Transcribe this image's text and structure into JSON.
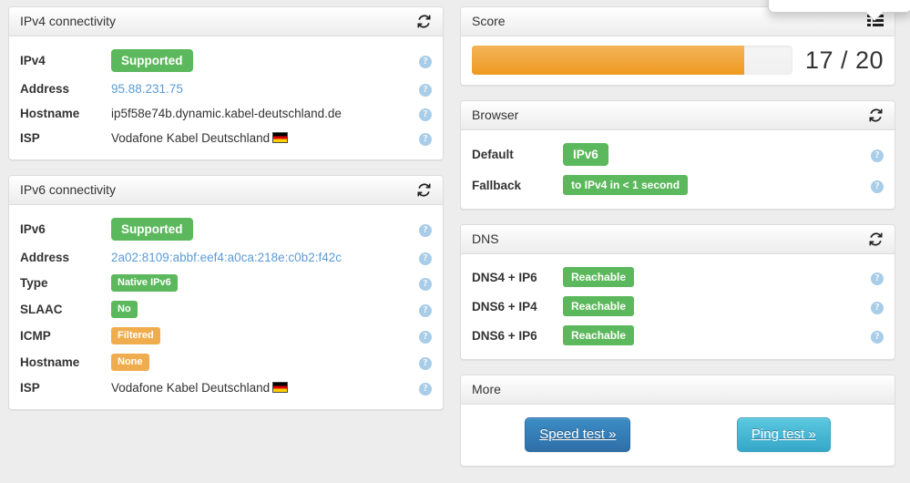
{
  "colors": {
    "green": "#5cb85c",
    "orange": "#f0ad4e",
    "link_blue": "#5b9bd5",
    "btn_primary": "#3276b1",
    "btn_info": "#49afcd",
    "page_bg": "#ededed"
  },
  "ipv4_panel": {
    "title": "IPv4 connectivity",
    "refresh_icon": "refresh-icon",
    "rows": [
      {
        "label": "IPv4",
        "type": "badge-lg",
        "value": "Supported",
        "style": "green",
        "help": "?"
      },
      {
        "label": "Address",
        "type": "link",
        "value": "95.88.231.75",
        "style": "link",
        "help": "?"
      },
      {
        "label": "Hostname",
        "type": "text",
        "value": "ip5f58e74b.dynamic.kabel-deutschland.de",
        "style": "plain",
        "help": "?"
      },
      {
        "label": "ISP",
        "type": "text-flag",
        "value": "Vodafone Kabel Deutschland",
        "style": "plain",
        "flag": "de-flag-icon",
        "help": "?"
      }
    ]
  },
  "ipv6_panel": {
    "title": "IPv6 connectivity",
    "refresh_icon": "refresh-icon",
    "rows": [
      {
        "label": "IPv6",
        "type": "badge-lg",
        "value": "Supported",
        "style": "green",
        "help": "?"
      },
      {
        "label": "Address",
        "type": "link",
        "value": "2a02:8109:abbf:eef4:a0ca:218e:c0b2:f42c",
        "style": "link",
        "help": "?"
      },
      {
        "label": "Type",
        "type": "badge-sm",
        "value": "Native IPv6",
        "style": "green",
        "help": "?"
      },
      {
        "label": "SLAAC",
        "type": "badge-sm",
        "value": "No",
        "style": "green",
        "help": "?"
      },
      {
        "label": "ICMP",
        "type": "badge-sm",
        "value": "Filtered",
        "style": "orange",
        "help": "?"
      },
      {
        "label": "Hostname",
        "type": "badge-sm",
        "value": "None",
        "style": "orange",
        "help": "?"
      },
      {
        "label": "ISP",
        "type": "text-flag",
        "value": "Vodafone Kabel Deutschland",
        "style": "plain",
        "flag": "de-flag-icon",
        "help": "?"
      }
    ]
  },
  "score_panel": {
    "title": "Score",
    "list_icon": "list-icon",
    "score_text": "17 / 20",
    "score_value": 17,
    "score_max": 20,
    "percent": 85
  },
  "popover": {
    "visible": true
  },
  "browser_panel": {
    "title": "Browser",
    "refresh_icon": "refresh-icon",
    "rows": [
      {
        "label": "Default",
        "type": "badge-lg",
        "value": "IPv6",
        "style": "green",
        "help": "?"
      },
      {
        "label": "Fallback",
        "type": "badge-md",
        "value": "to IPv4 in < 1 second",
        "style": "green",
        "help": "?"
      }
    ]
  },
  "dns_panel": {
    "title": "DNS",
    "refresh_icon": "refresh-icon",
    "rows": [
      {
        "label": "DNS4 + IP6",
        "type": "badge-md",
        "value": "Reachable",
        "style": "green",
        "help": "?"
      },
      {
        "label": "DNS6 + IP4",
        "type": "badge-md",
        "value": "Reachable",
        "style": "green",
        "help": "?"
      },
      {
        "label": "DNS6 + IP6",
        "type": "badge-md",
        "value": "Reachable",
        "style": "green",
        "help": "?"
      }
    ]
  },
  "more_panel": {
    "title": "More",
    "buttons": [
      {
        "label": "Speed test »",
        "style": "primary"
      },
      {
        "label": "Ping test »",
        "style": "info"
      }
    ]
  }
}
